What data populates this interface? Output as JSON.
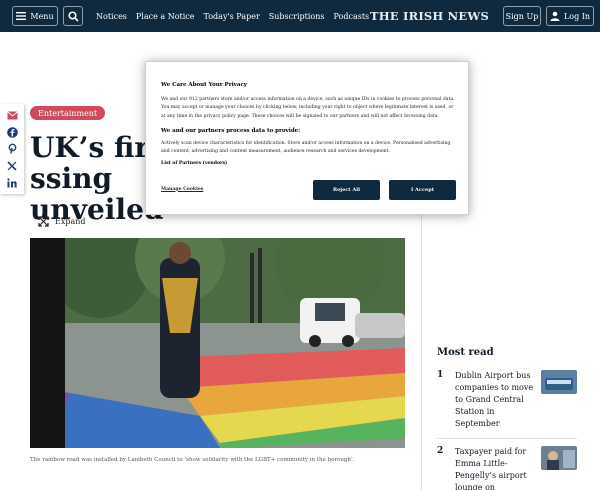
{
  "header": {
    "menu_label": "Menu",
    "nav": [
      "Notices",
      "Place a Notice",
      "Today's Paper",
      "Subscriptions",
      "Podcasts"
    ],
    "brand": "THE IRISH NEWS",
    "signup_label": "Sign Up",
    "login_label": "Log In"
  },
  "article": {
    "category": "Entertainment",
    "headline_start": "UK’s first",
    "headline_end": "ssing",
    "headline_line2": "unveiled",
    "expand_label": "Expand",
    "caption": "The rainbow road was installed by Lambeth Council to ‘show solidarity with the LGBT+ community in the borough’."
  },
  "most_read": {
    "title": "Most read",
    "items": [
      {
        "rank": "1",
        "title": "Dublin Airport bus companies to move to Grand Central Station in September"
      },
      {
        "rank": "2",
        "title": "Taxpayer paid for Emma Little-Pengelly’s airport lounge on"
      }
    ]
  },
  "consent": {
    "title": "We Care About Your Privacy",
    "body": "We and our 912 partners store and/or access information on a device, such as unique IDs in cookies to process personal data. You may accept or manage your choices by clicking below, including your right to object where legitimate interest is used, or at any time in the privacy policy page. These choices will be signaled to our partners and will not affect browsing data.",
    "subtitle": "We and our partners process data to provide:",
    "body2": "Actively scan device characteristics for identification. Store and/or access information on a device. Personalised advertising and content, advertising and content measurement, audience research and services development.",
    "vendors_label": "List of Partners (vendors)",
    "manage_label": "Manage Cookies",
    "reject_label": "Reject All",
    "accept_label": "I Accept"
  },
  "colors": {
    "header_bg": "#0f2a3f",
    "category_bg": "#d1495b",
    "button_bg": "#0f2a3f"
  }
}
